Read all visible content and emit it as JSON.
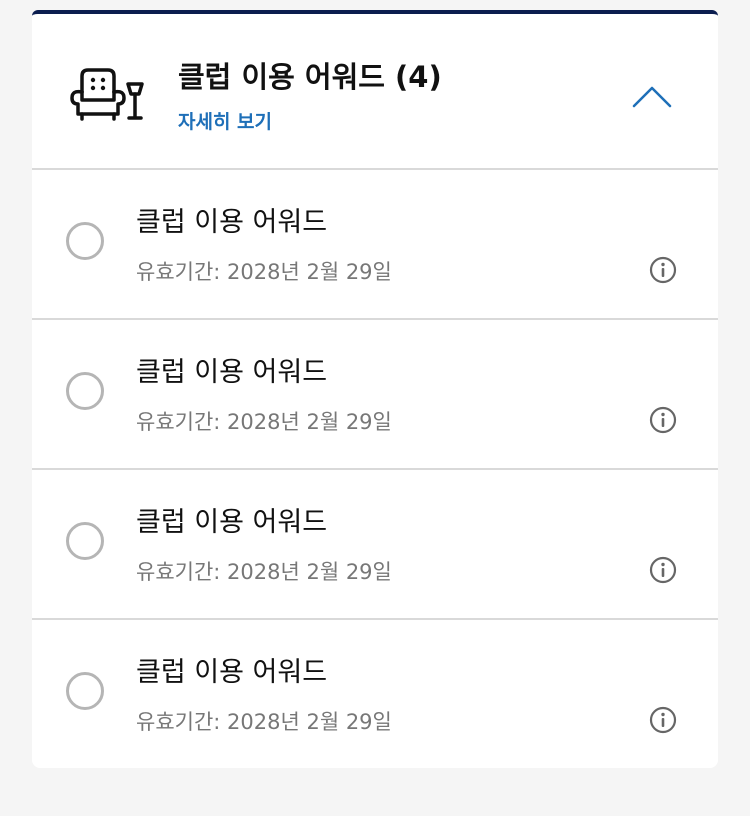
{
  "section": {
    "title": "클럽 이용 어워드 (4)",
    "detail_link": "자세히 보기",
    "header_icon": "armchair-lamp-icon",
    "collapse_icon": "chevron-up-icon",
    "accent_color": "#0b1d4f",
    "link_color": "#1e6fb8"
  },
  "awards": [
    {
      "title": "클럽 이용 어워드",
      "validity": "유효기간: 2028년 2월 29일"
    },
    {
      "title": "클럽 이용 어워드",
      "validity": "유효기간: 2028년 2월 29일"
    },
    {
      "title": "클럽 이용 어워드",
      "validity": "유효기간: 2028년 2월 29일"
    },
    {
      "title": "클럽 이용 어워드",
      "validity": "유효기간: 2028년 2월 29일"
    }
  ]
}
